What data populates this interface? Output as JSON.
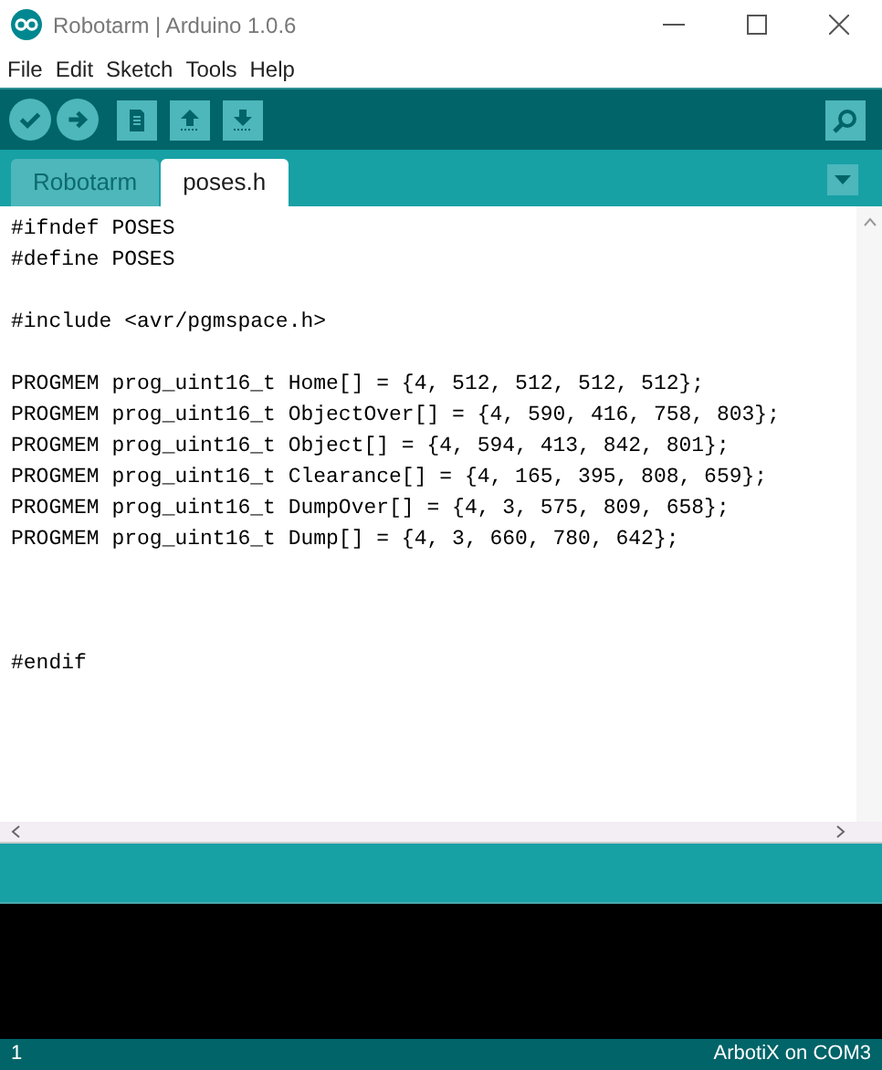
{
  "window": {
    "title": "Robotarm | Arduino 1.0.6"
  },
  "menu": [
    "File",
    "Edit",
    "Sketch",
    "Tools",
    "Help"
  ],
  "tabs": [
    {
      "label": "Robotarm",
      "selected": false
    },
    {
      "label": "poses.h",
      "selected": true
    }
  ],
  "code_lines": [
    {
      "kind": "text",
      "text": "#ifndef POSES"
    },
    {
      "kind": "text",
      "text": "#define POSES"
    },
    {
      "kind": "blank"
    },
    {
      "kind": "text",
      "text": "#include <avr/pgmspace.h>"
    },
    {
      "kind": "blank"
    },
    {
      "kind": "text",
      "text": "PROGMEM prog_uint16_t Home[] = {4, 512, 512, 512, 512};"
    },
    {
      "kind": "text",
      "text": "PROGMEM prog_uint16_t ObjectOver[] = {4, 590, 416, 758, 803};"
    },
    {
      "kind": "text",
      "text": "PROGMEM prog_uint16_t Object[] = {4, 594, 413, 842, 801};"
    },
    {
      "kind": "text",
      "text": "PROGMEM prog_uint16_t Clearance[] = {4, 165, 395, 808, 659};"
    },
    {
      "kind": "text",
      "text": "PROGMEM prog_uint16_t DumpOver[] = {4, 3, 575, 809, 658};"
    },
    {
      "kind": "text",
      "text": "PROGMEM prog_uint16_t Dump[] = {4, 3, 660, 780, 642};"
    },
    {
      "kind": "blank"
    },
    {
      "kind": "blank"
    },
    {
      "kind": "blank"
    },
    {
      "kind": "text",
      "text": "#endif"
    }
  ],
  "status_bar": {
    "line": "1",
    "board": "ArbotiX on COM3"
  }
}
